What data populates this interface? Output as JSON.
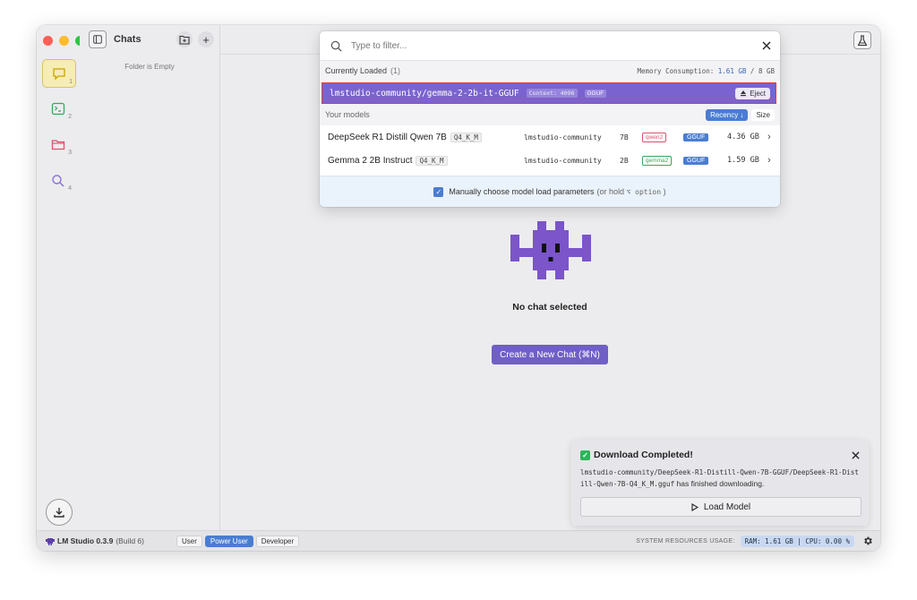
{
  "sidebar": {
    "title": "Chats",
    "empty_text": "Folder is Empty",
    "add_symbol": "+",
    "rail_items": [
      {
        "name": "chat-icon",
        "badge": "1",
        "color": "#c9a400"
      },
      {
        "name": "terminal-icon",
        "badge": "2",
        "color": "#3aa55a"
      },
      {
        "name": "folder-icon",
        "badge": "3",
        "color": "#e0506b"
      },
      {
        "name": "search-icon",
        "badge": "4",
        "color": "#8a6fd6"
      }
    ]
  },
  "popover": {
    "filter_placeholder": "Type to filter...",
    "currently_loaded_label": "Currently Loaded",
    "currently_loaded_count": "(1)",
    "memory_label": "Memory Consumption:",
    "memory_used": "1.61 GB",
    "memory_total": "8 GB",
    "loaded_model": {
      "name": "lmstudio-community/gemma-2-2b-it-GGUF",
      "context": "Context: 4096",
      "format": "GGUF",
      "eject_label": "Eject"
    },
    "your_models_label": "Your models",
    "sort_recency": "Recency ↓",
    "sort_size": "Size",
    "models": [
      {
        "name": "DeepSeek R1 Distill Qwen 7B",
        "quant": "Q4_K_M",
        "publisher": "lmstudio-community",
        "params": "7B",
        "arch": "qwen2",
        "arch_color": "#e0506b",
        "format": "GGUF",
        "size": "4.36 GB"
      },
      {
        "name": "Gemma 2 2B Instruct",
        "quant": "Q4_K_M",
        "publisher": "lmstudio-community",
        "params": "2B",
        "arch": "gemma2",
        "arch_color": "#3aa55a",
        "format": "GGUF",
        "size": "1.59 GB"
      }
    ],
    "manual_label": "Manually choose model load parameters",
    "manual_hint_pre": "(or hold",
    "manual_hint_key": "⌥ option",
    "manual_hint_post": ")"
  },
  "main": {
    "no_chat_text": "No chat selected",
    "new_chat_button": "Create a New Chat (⌘N)"
  },
  "toast": {
    "title": "Download Completed!",
    "path": "lmstudio-community/DeepSeek-R1-Distill-Qwen-7B-GGUF/DeepSeek-R1-Distill-Qwen-7B-Q4_K_M.gguf",
    "suffix": "has finished downloading.",
    "load_button": "Load Model"
  },
  "statusbar": {
    "brand": "LM Studio 0.3.9",
    "build": "(Build 6)",
    "modes": [
      "User",
      "Power User",
      "Developer"
    ],
    "active_mode": "Power User",
    "sysres_label": "SYSTEM RESOURCES USAGE:",
    "ram": "RAM: 1.61 GB",
    "cpu": "CPU: 0.00 %"
  },
  "colors": {
    "accent": "#4a7dd1",
    "loaded_row": "#7a63cf",
    "mascot": "#7b55c9"
  }
}
